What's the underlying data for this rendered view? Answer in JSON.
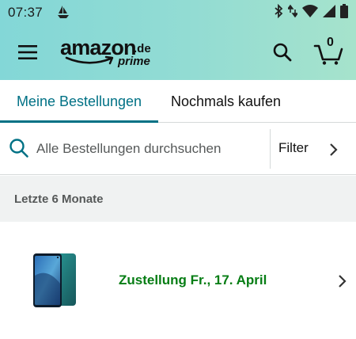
{
  "status_bar": {
    "time": "07:37",
    "left_icon": "sailboat-icon",
    "right_icons": [
      "bluetooth-icon",
      "data-arrows-icon",
      "wifi-icon",
      "signal-icon",
      "battery-icon"
    ]
  },
  "header": {
    "menu_icon": "hamburger-menu-icon",
    "logo": {
      "word": "amazon",
      "tld": ".de",
      "sub": "prime"
    },
    "search_icon": "search-icon",
    "cart_icon": "cart-icon",
    "cart_count": "0"
  },
  "tabs": [
    {
      "label": "Meine Bestellungen",
      "active": true
    },
    {
      "label": "Nochmals kaufen",
      "active": false
    }
  ],
  "search": {
    "placeholder": "Alle Bestellungen durchsuchen",
    "filter_label": "Filter"
  },
  "section": {
    "label": "Letzte 6 Monate"
  },
  "orders": [
    {
      "image_icon": "smartphone-product-image",
      "delivery_text": "Zustellung Fr., 17. April"
    }
  ],
  "colors": {
    "header_gradient_start": "#83d7d7",
    "header_gradient_end": "#a6e3cc",
    "accent_teal": "#007185",
    "delivery_green": "#067d14",
    "section_bg": "#f0f2f2"
  }
}
